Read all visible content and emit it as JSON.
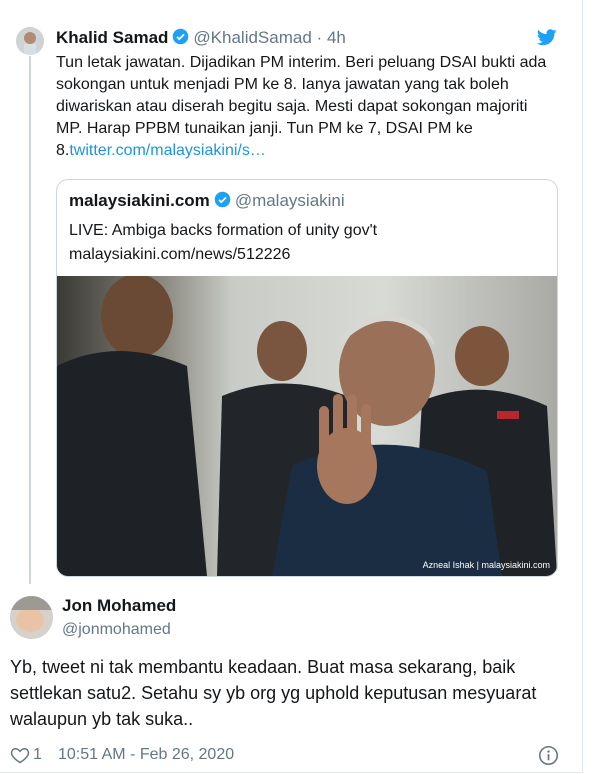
{
  "tweet": {
    "author_name": "Khalid Samad",
    "author_handle": "@KhalidSamad",
    "separator": "·",
    "time": "4h",
    "text": "Tun letak jawatan. Dijadikan PM interim. Beri peluang DSAI bukti ada sokongan untuk menjadi PM ke 8. Ianya jawatan yang tak boleh diwariskan atau diserah begitu saja. Mesti dapat sokongan majoriti MP. Harap PPBM tunaikan janji. Tun PM ke 7, DSAI PM ke 8.",
    "link": "twitter.com/malaysiakini/s…"
  },
  "quoted": {
    "author_name": "malaysiakini.com",
    "author_handle": "@malaysiakini",
    "headline": "LIVE: Ambiga backs formation of unity gov't",
    "url": "malaysiakini.com/news/512226",
    "photo_credit": "Azneal Ishak | malaysiakini.com"
  },
  "reply": {
    "author_name": "Jon Mohamed",
    "author_handle": "@jonmohamed",
    "text": "Yb, tweet ni tak membantu keadaan. Buat masa sekarang, baik settlekan satu2. Setahu sy yb org yg uphold keputusan mesyuarat walaupun yb tak suka..",
    "like_count": "1",
    "timestamp": "10:51 AM - Feb 26, 2020"
  },
  "colors": {
    "link": "#1b95e0",
    "verified": "#1da1f2",
    "muted": "#657786",
    "border": "#ccd6dd"
  },
  "icons": [
    "twitter-bird-icon",
    "verified-badge-icon",
    "heart-icon",
    "info-icon"
  ]
}
